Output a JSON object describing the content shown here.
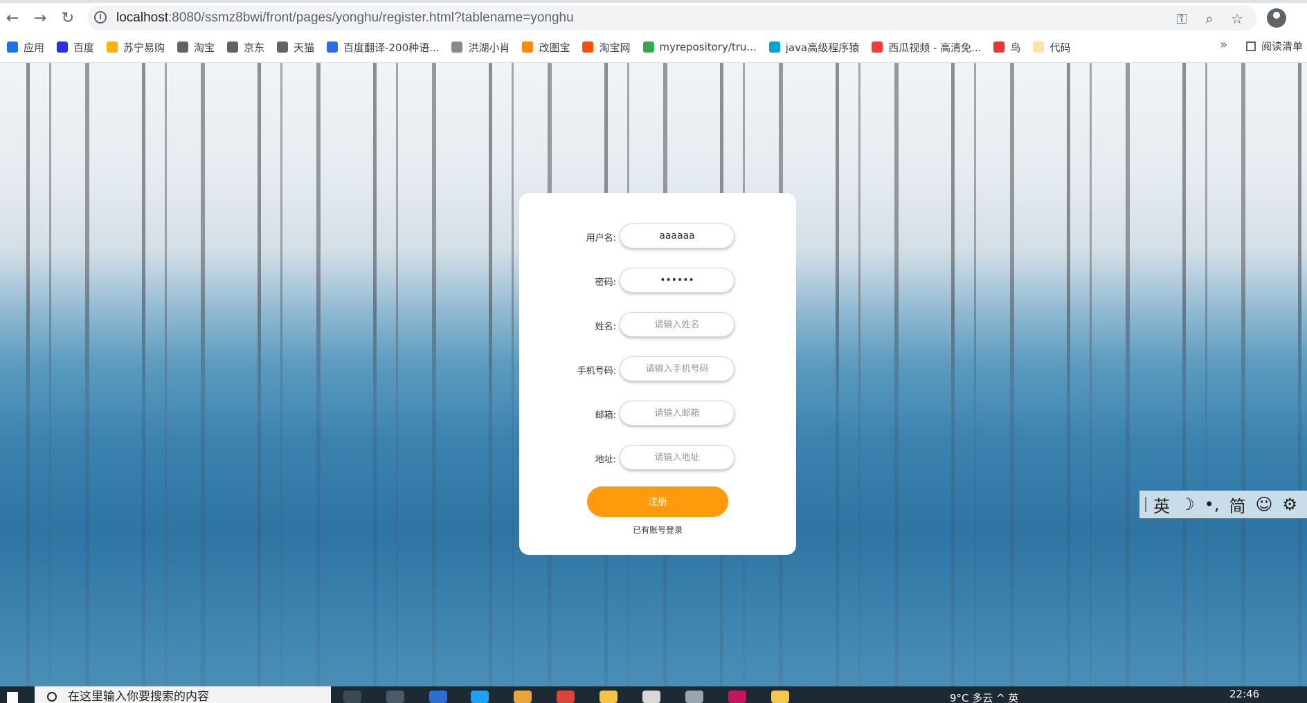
{
  "browser": {
    "url_host": "localhost",
    "url_rest": ":8080/ssmz8bwi/front/pages/yonghu/register.html?tablename=yonghu",
    "bookmarks": [
      {
        "label": "应用",
        "color": "#1a73e8"
      },
      {
        "label": "百度",
        "color": "#2932e1"
      },
      {
        "label": "苏宁易购",
        "color": "#f7b500"
      },
      {
        "label": "淘宝",
        "color": "#5f6368"
      },
      {
        "label": "京东",
        "color": "#5f6368"
      },
      {
        "label": "天猫",
        "color": "#5f6368"
      },
      {
        "label": "百度翻译-200种语...",
        "color": "#2b6de8"
      },
      {
        "label": "洪湖小肖",
        "color": "#888888"
      },
      {
        "label": "改图宝",
        "color": "#ff8a00"
      },
      {
        "label": "淘宝网",
        "color": "#ff5000"
      },
      {
        "label": "myrepository/tru...",
        "color": "#34a853"
      },
      {
        "label": "java高级程序猿",
        "color": "#00a1d6"
      },
      {
        "label": "西瓜视频 - 高清免...",
        "color": "#f53b3b"
      },
      {
        "label": "鸟",
        "color": "#e53935"
      },
      {
        "label": "代码",
        "color": "#f5e6a8"
      }
    ],
    "more_label": "»",
    "reading_list": "阅读清单"
  },
  "form": {
    "fields": [
      {
        "label": "用户名:",
        "value": "aaaaaa",
        "placeholder": "",
        "type": "text"
      },
      {
        "label": "密码:",
        "value": "aaaaaa",
        "placeholder": "",
        "type": "password"
      },
      {
        "label": "姓名:",
        "value": "",
        "placeholder": "请输入姓名",
        "type": "text"
      },
      {
        "label": "手机号码:",
        "value": "",
        "placeholder": "请输入手机号码",
        "type": "text"
      },
      {
        "label": "邮箱:",
        "value": "",
        "placeholder": "请输入邮箱",
        "type": "text"
      },
      {
        "label": "地址:",
        "value": "",
        "placeholder": "请输入地址",
        "type": "text"
      }
    ],
    "submit_label": "注册",
    "login_link": "已有账号登录",
    "accent_color": "#ff9a0a"
  },
  "ime": {
    "items": [
      "英",
      "☽",
      "•,",
      "简",
      "☺",
      "⚙"
    ]
  },
  "taskbar": {
    "search_text": "在这里输入你要搜索的内容",
    "tray_text": "9°C 多云  ^  英",
    "time": "22:46"
  }
}
